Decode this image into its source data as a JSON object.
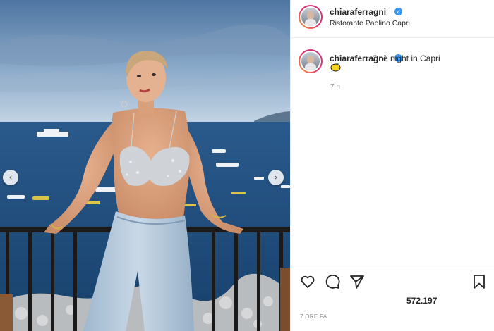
{
  "post": {
    "username": "chiaraferragni",
    "location": "Ristorante Paolino Capri",
    "caption": "One night in Capri",
    "caption_emoji": "lemon-icon",
    "comment_time": "7 h",
    "likes": "572.197",
    "date": "7 ORE FA",
    "verified_badge": "verified-icon"
  },
  "media": {
    "prev_icon": "chevron-left-icon",
    "next_icon": "chevron-right-icon",
    "description_colors": {
      "sky_top": "#5a7ea8",
      "sky_horizon": "#b9cde0",
      "sea": "#1f4f80",
      "railing": "#1a1a1a"
    }
  },
  "actions": {
    "like_icon": "heart-icon",
    "comment_icon": "comment-icon",
    "share_icon": "paper-plane-icon",
    "save_icon": "bookmark-icon"
  },
  "colors": {
    "verified": "#3897f0",
    "text": "#262626",
    "muted": "#8e8e8e",
    "border": "#efefef"
  }
}
